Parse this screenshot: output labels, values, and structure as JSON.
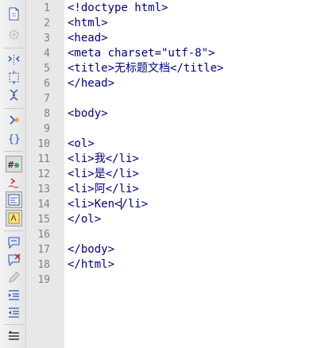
{
  "toolbar": {
    "icons": [
      "new-page-icon",
      "settings-gear-icon",
      "expand-selection-icon",
      "select-block-icon",
      "collapse-icon",
      "bookmark-icon",
      "brace-match-icon",
      "line-numbers-toggle-icon",
      "wordwrap-toggle-icon",
      "show-invisibles-icon",
      "highlight-icon",
      "comment-icon",
      "uncomment-icon",
      "edit-pencil-icon",
      "indent-icon",
      "outdent-icon",
      "align-icon"
    ]
  },
  "editor": {
    "line_numbers": [
      "1",
      "2",
      "3",
      "4",
      "5",
      "6",
      "7",
      "8",
      "9",
      "10",
      "11",
      "12",
      "13",
      "14",
      "15",
      "16",
      "17",
      "18",
      "19"
    ],
    "lines": [
      "<!doctype html>",
      "<html>",
      "<head>",
      "<meta charset=\"utf-8\">",
      "<title>无标题文档</title>",
      "</head>",
      "",
      "<body>",
      "",
      "<ol>",
      "<li>我</li>",
      "<li>是</li>",
      "<li>阿</li>",
      "<li>Ken</li>",
      "</ol>",
      "",
      "</body>",
      "</html>",
      ""
    ],
    "caret_line": 14
  }
}
